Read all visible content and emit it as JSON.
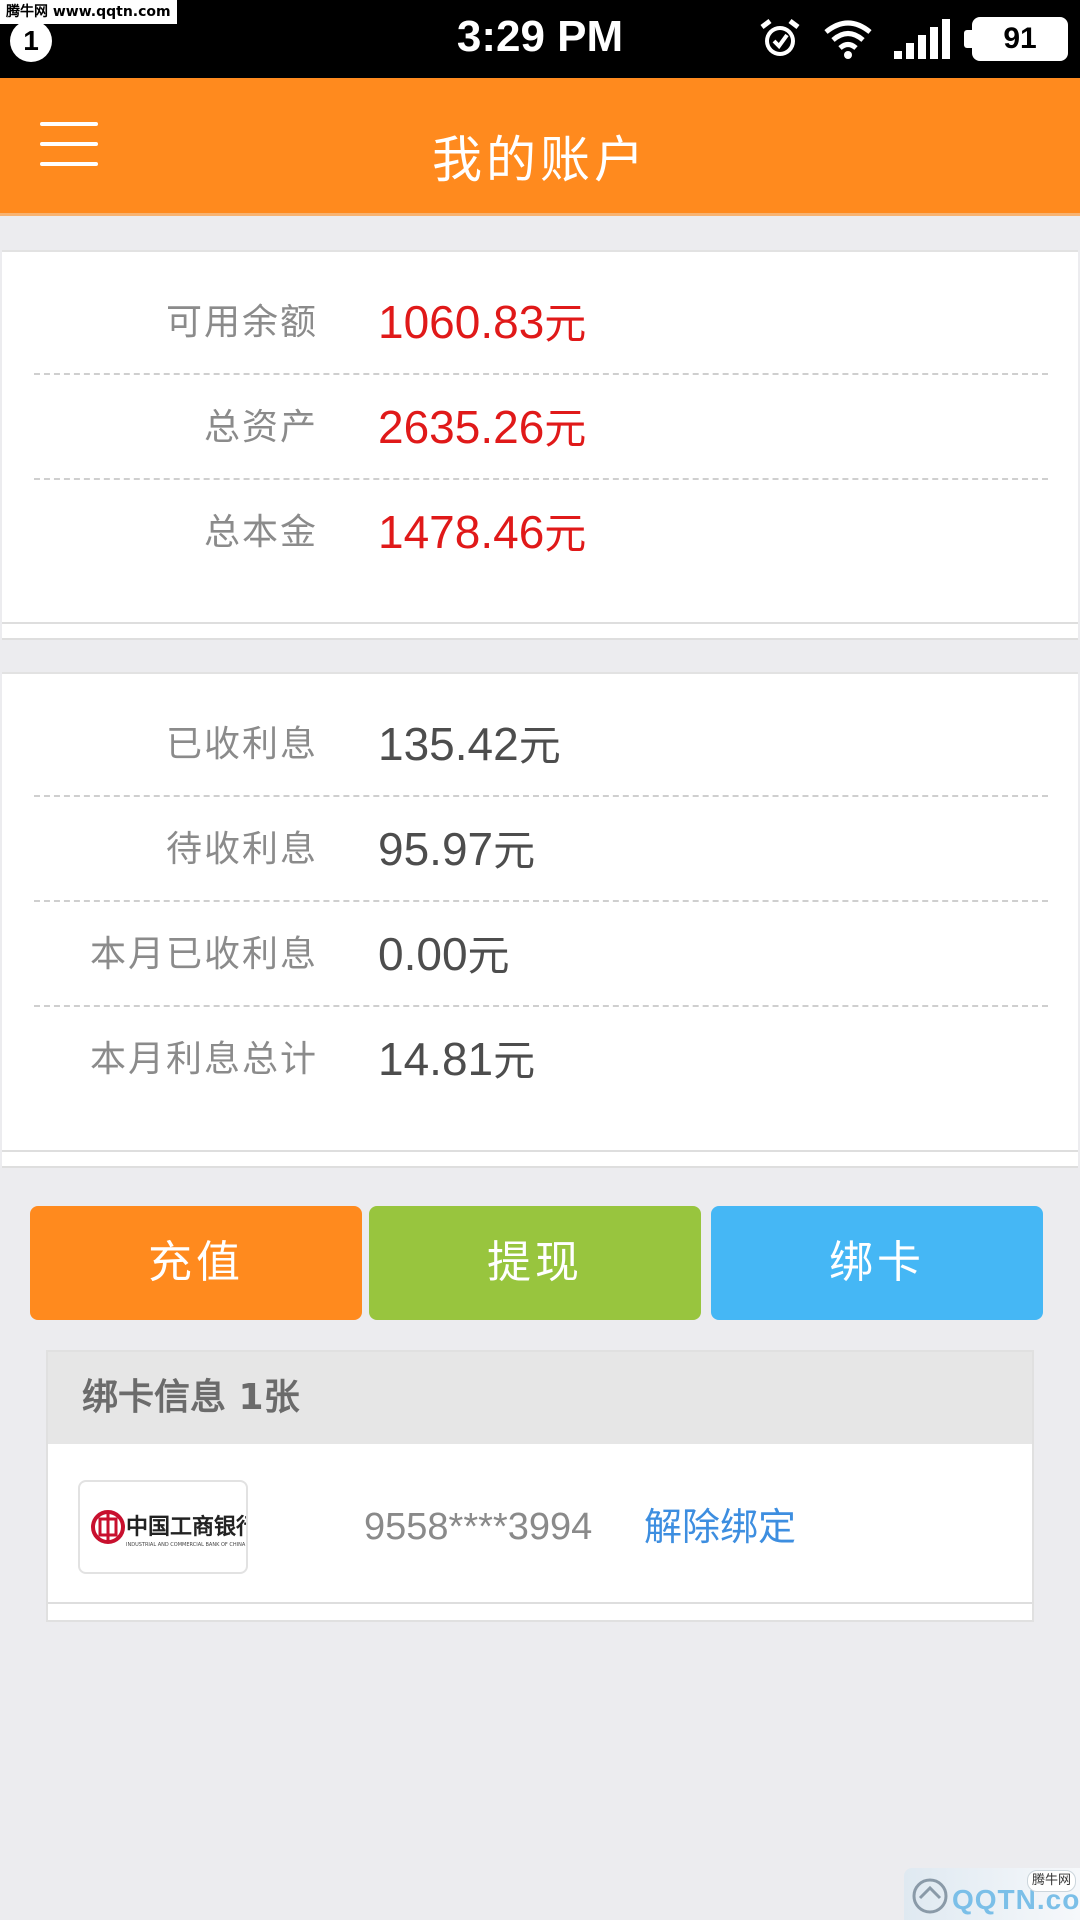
{
  "status_bar": {
    "watermark": "腾牛网 www.qqtn.com",
    "notification_count": "1",
    "time": "3:29 PM",
    "battery": "91"
  },
  "header": {
    "title": "我的账户"
  },
  "balance_card": {
    "rows": [
      {
        "label": "可用余额",
        "value": "1060.83",
        "unit": "元"
      },
      {
        "label": "总资产",
        "value": "2635.26",
        "unit": "元"
      },
      {
        "label": "总本金",
        "value": "1478.46",
        "unit": "元"
      }
    ]
  },
  "interest_card": {
    "rows": [
      {
        "label": "已收利息",
        "value": "135.42",
        "unit": "元"
      },
      {
        "label": "待收利息",
        "value": "95.97",
        "unit": "元"
      },
      {
        "label": "本月已收利息",
        "value": "0.00",
        "unit": "元"
      },
      {
        "label": "本月利息总计",
        "value": "14.81",
        "unit": "元"
      }
    ]
  },
  "actions": {
    "recharge": "充值",
    "withdraw": "提现",
    "bind_card": "绑卡"
  },
  "bound_cards": {
    "title": "绑卡信息 1张",
    "bank_logo_text": "中国工商银行",
    "bank_logo_subtext": "INDUSTRIAL AND COMMERCIAL BANK OF CHINA",
    "card_number": "9558****3994",
    "unbind_label": "解除绑定"
  },
  "corner_watermark": {
    "brand": "QQTN.com",
    "tag": "腾牛网"
  },
  "colors": {
    "header": "#ff8a1e",
    "recharge": "#ff8a1e",
    "withdraw": "#98c53e",
    "bind_card": "#45b7f5",
    "value_red": "#e01919",
    "link_blue": "#3d8ee0"
  }
}
